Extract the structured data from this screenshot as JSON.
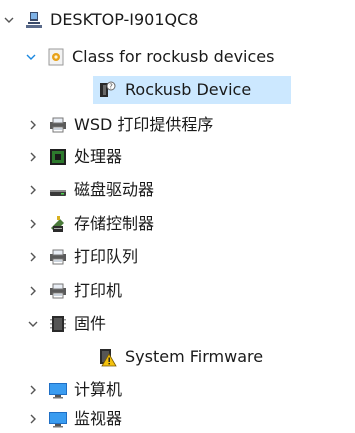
{
  "tree": {
    "root": {
      "label": "DESKTOP-I901QC8",
      "icon": "computer-network-icon",
      "expanded": true
    },
    "items": [
      {
        "label": "Class for rockusb devices",
        "icon": "device-class-icon",
        "expanded": true
      },
      {
        "label": "Rockusb Device",
        "icon": "unknown-device-icon",
        "selected": true
      },
      {
        "label": "WSD 打印提供程序",
        "icon": "printer-icon",
        "expanded": false
      },
      {
        "label": "处理器",
        "icon": "processor-icon",
        "expanded": false
      },
      {
        "label": "磁盘驱动器",
        "icon": "disk-drive-icon",
        "expanded": false
      },
      {
        "label": "存储控制器",
        "icon": "storage-controller-icon",
        "expanded": false
      },
      {
        "label": "打印队列",
        "icon": "printer-icon",
        "expanded": false
      },
      {
        "label": "打印机",
        "icon": "printer-icon",
        "expanded": false
      },
      {
        "label": "固件",
        "icon": "firmware-icon",
        "expanded": true
      },
      {
        "label": "System Firmware",
        "icon": "firmware-warning-icon"
      },
      {
        "label": "计算机",
        "icon": "monitor-icon",
        "expanded": false
      },
      {
        "label": "监视器",
        "icon": "monitor-icon",
        "expanded": false
      }
    ]
  },
  "colors": {
    "selection": "#cce8ff",
    "chevron": "#555555",
    "chevron_expanded_accent": "#1a88e0"
  }
}
